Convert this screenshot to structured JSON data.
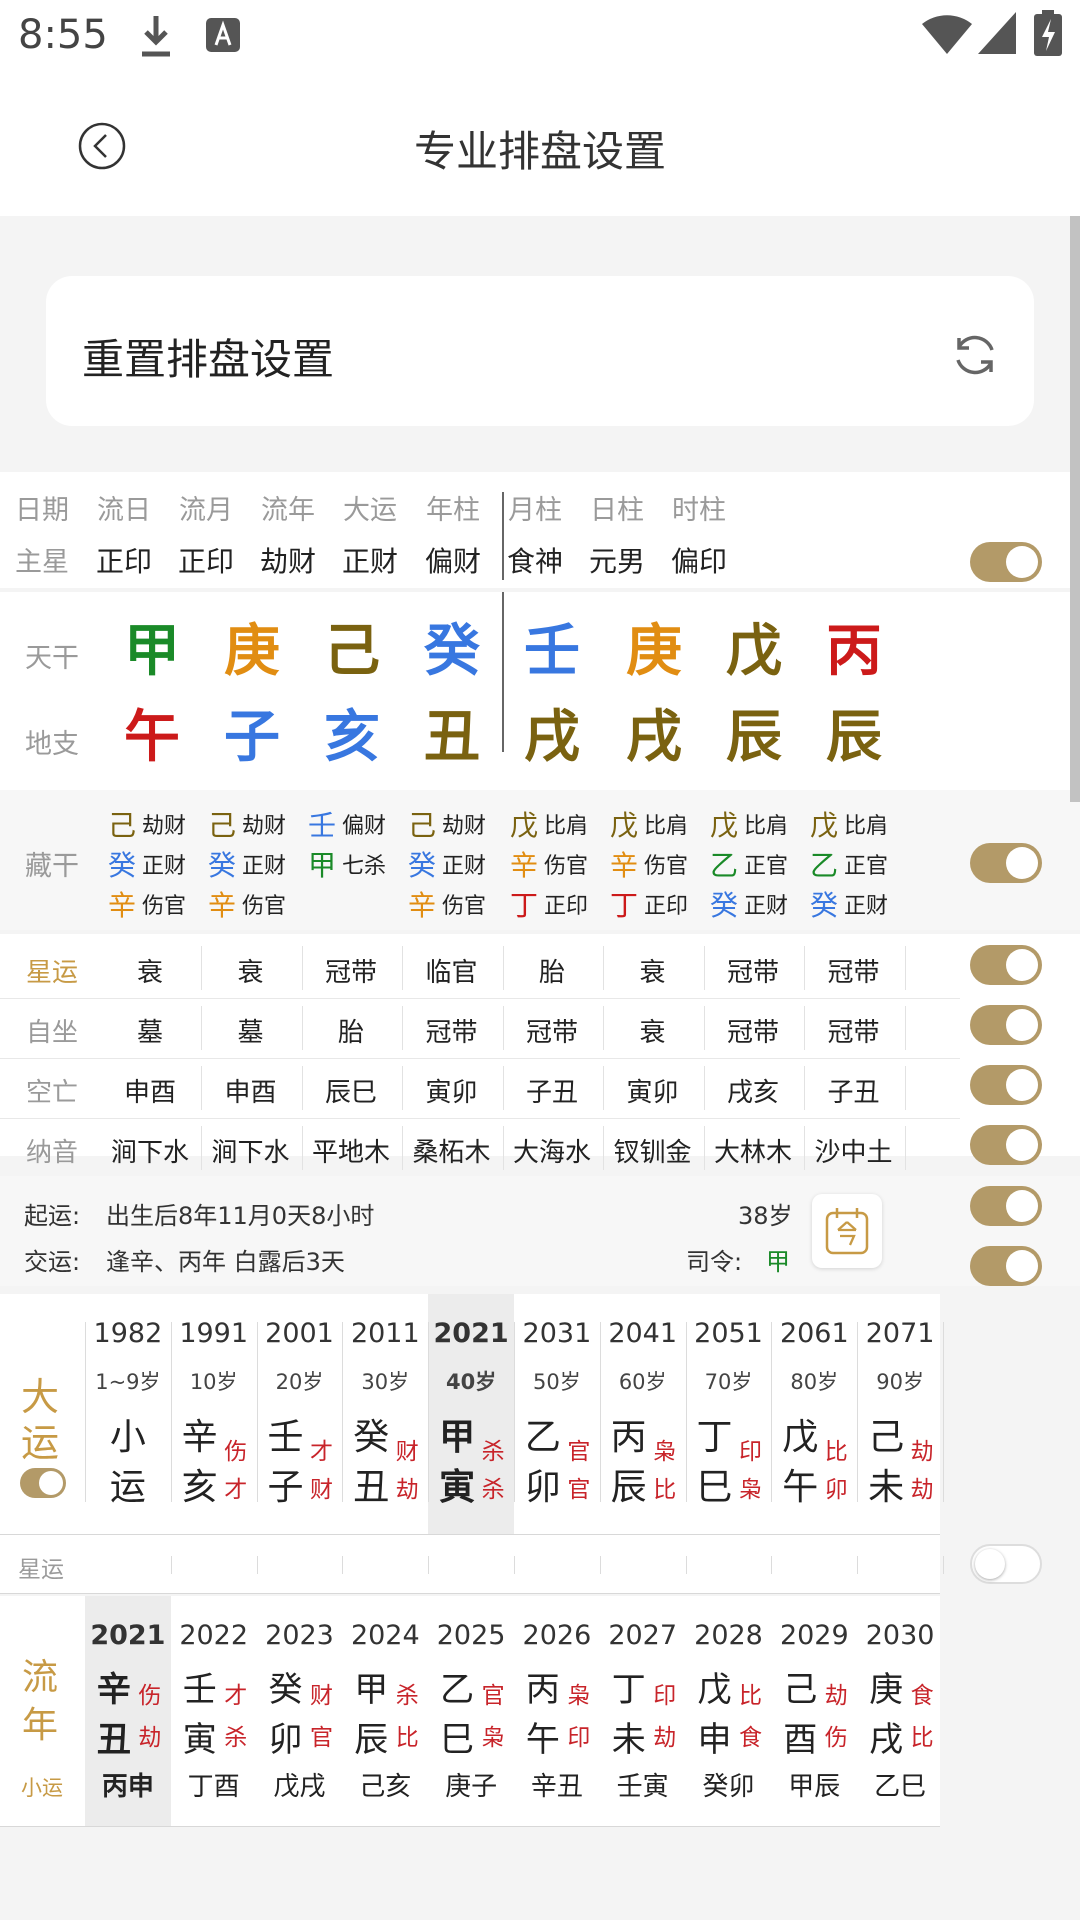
{
  "status": {
    "time": "8:55"
  },
  "header": {
    "title": "专业排盘设置"
  },
  "reset": {
    "label": "重置排盘设置"
  },
  "pillars": {
    "top": [
      "日期",
      "流日",
      "流月",
      "流年",
      "大运",
      "年柱",
      "月柱",
      "日柱",
      "时柱"
    ],
    "main_star_label": "主星",
    "main_stars": [
      "正印",
      "正印",
      "劫财",
      "正财",
      "偏财",
      "食神",
      "元男",
      "偏印"
    ],
    "tiangan_label": "天干",
    "dizhi_label": "地支",
    "tiangan": [
      "甲",
      "庚",
      "己",
      "癸",
      "壬",
      "庚",
      "戊",
      "丙"
    ],
    "dizhi": [
      "午",
      "子",
      "亥",
      "丑",
      "戌",
      "戌",
      "辰",
      "辰"
    ],
    "canggan_label": "藏干",
    "canggan": [
      [
        [
          "己",
          "劫财"
        ],
        [
          "癸",
          "正财"
        ],
        [
          "辛",
          "伤官"
        ]
      ],
      [
        [
          "己",
          "劫财"
        ],
        [
          "癸",
          "正财"
        ],
        [
          "辛",
          "伤官"
        ]
      ],
      [
        [
          "壬",
          "偏财"
        ],
        [
          "甲",
          "七杀"
        ]
      ],
      [
        [
          "己",
          "劫财"
        ],
        [
          "癸",
          "正财"
        ],
        [
          "辛",
          "伤官"
        ]
      ],
      [
        [
          "戊",
          "比肩"
        ],
        [
          "辛",
          "伤官"
        ],
        [
          "丁",
          "正印"
        ]
      ],
      [
        [
          "戊",
          "比肩"
        ],
        [
          "辛",
          "伤官"
        ],
        [
          "丁",
          "正印"
        ]
      ],
      [
        [
          "戊",
          "比肩"
        ],
        [
          "乙",
          "正官"
        ],
        [
          "癸",
          "正财"
        ]
      ],
      [
        [
          "戊",
          "比肩"
        ],
        [
          "乙",
          "正官"
        ],
        [
          "癸",
          "正财"
        ]
      ]
    ]
  },
  "rows": [
    {
      "label": "星运",
      "values": [
        "衰",
        "衰",
        "冠带",
        "临官",
        "胎",
        "衰",
        "冠带",
        "冠带"
      ]
    },
    {
      "label": "自坐",
      "values": [
        "墓",
        "墓",
        "胎",
        "冠带",
        "冠带",
        "衰",
        "冠带",
        "冠带"
      ]
    },
    {
      "label": "空亡",
      "values": [
        "申酉",
        "申酉",
        "辰巳",
        "寅卯",
        "子丑",
        "寅卯",
        "戌亥",
        "子丑"
      ]
    },
    {
      "label": "纳音",
      "values": [
        "涧下水",
        "涧下水",
        "平地木",
        "桑柘木",
        "大海水",
        "钗钏金",
        "大林木",
        "沙中土"
      ]
    }
  ],
  "qiyun": {
    "label": "起运:",
    "text": "出生后8年11月0天8小时",
    "age": "38岁"
  },
  "jiaoyun": {
    "label": "交运:",
    "text": "逢辛、丙年 白露后3天",
    "siling_label": "司令:",
    "siling_value": "甲"
  },
  "dayun": {
    "label": [
      "大",
      "运"
    ],
    "cols": [
      {
        "year": "1982",
        "age": "1~9岁",
        "g": "小",
        "gl": "",
        "z": "运",
        "zl": ""
      },
      {
        "year": "1991",
        "age": "10岁",
        "g": "辛",
        "gl": "伤",
        "z": "亥",
        "zl": "才"
      },
      {
        "year": "2001",
        "age": "20岁",
        "g": "壬",
        "gl": "才",
        "z": "子",
        "zl": "财"
      },
      {
        "year": "2011",
        "age": "30岁",
        "g": "癸",
        "gl": "财",
        "z": "丑",
        "zl": "劫"
      },
      {
        "year": "2021",
        "age": "40岁",
        "g": "甲",
        "gl": "杀",
        "z": "寅",
        "zl": "杀"
      },
      {
        "year": "2031",
        "age": "50岁",
        "g": "乙",
        "gl": "官",
        "z": "卯",
        "zl": "官"
      },
      {
        "year": "2041",
        "age": "60岁",
        "g": "丙",
        "gl": "枭",
        "z": "辰",
        "zl": "比"
      },
      {
        "year": "2051",
        "age": "70岁",
        "g": "丁",
        "gl": "印",
        "z": "巳",
        "zl": "枭"
      },
      {
        "year": "2061",
        "age": "80岁",
        "g": "戊",
        "gl": "比",
        "z": "午",
        "zl": "卯"
      },
      {
        "year": "2071",
        "age": "90岁",
        "g": "己",
        "gl": "劫",
        "z": "未",
        "zl": "劫"
      }
    ]
  },
  "xingyun2": {
    "label": "星运"
  },
  "liunian": {
    "label": [
      "流",
      "年"
    ],
    "xiaoyun_label": "小运",
    "cols": [
      {
        "year": "2021",
        "g": "辛",
        "gl": "伤",
        "z": "丑",
        "zl": "劫",
        "x": "丙申"
      },
      {
        "year": "2022",
        "g": "壬",
        "gl": "才",
        "z": "寅",
        "zl": "杀",
        "x": "丁酉"
      },
      {
        "year": "2023",
        "g": "癸",
        "gl": "财",
        "z": "卯",
        "zl": "官",
        "x": "戊戌"
      },
      {
        "year": "2024",
        "g": "甲",
        "gl": "杀",
        "z": "辰",
        "zl": "比",
        "x": "己亥"
      },
      {
        "year": "2025",
        "g": "乙",
        "gl": "官",
        "z": "巳",
        "zl": "枭",
        "x": "庚子"
      },
      {
        "year": "2026",
        "g": "丙",
        "gl": "枭",
        "z": "午",
        "zl": "印",
        "x": "辛丑"
      },
      {
        "year": "2027",
        "g": "丁",
        "gl": "印",
        "z": "未",
        "zl": "劫",
        "x": "壬寅"
      },
      {
        "year": "2028",
        "g": "戊",
        "gl": "比",
        "z": "申",
        "zl": "食",
        "x": "癸卯"
      },
      {
        "year": "2029",
        "g": "己",
        "gl": "劫",
        "z": "酉",
        "zl": "伤",
        "x": "甲辰"
      },
      {
        "year": "2030",
        "g": "庚",
        "gl": "食",
        "z": "戌",
        "zl": "比",
        "x": "乙巳"
      }
    ]
  },
  "colors": {
    "accent": "#b39a68",
    "wood": "#1a8a28",
    "fire": "#cc1a1a",
    "earth": "#7a6210",
    "metal": "#e18d12",
    "water": "#3877e0"
  }
}
